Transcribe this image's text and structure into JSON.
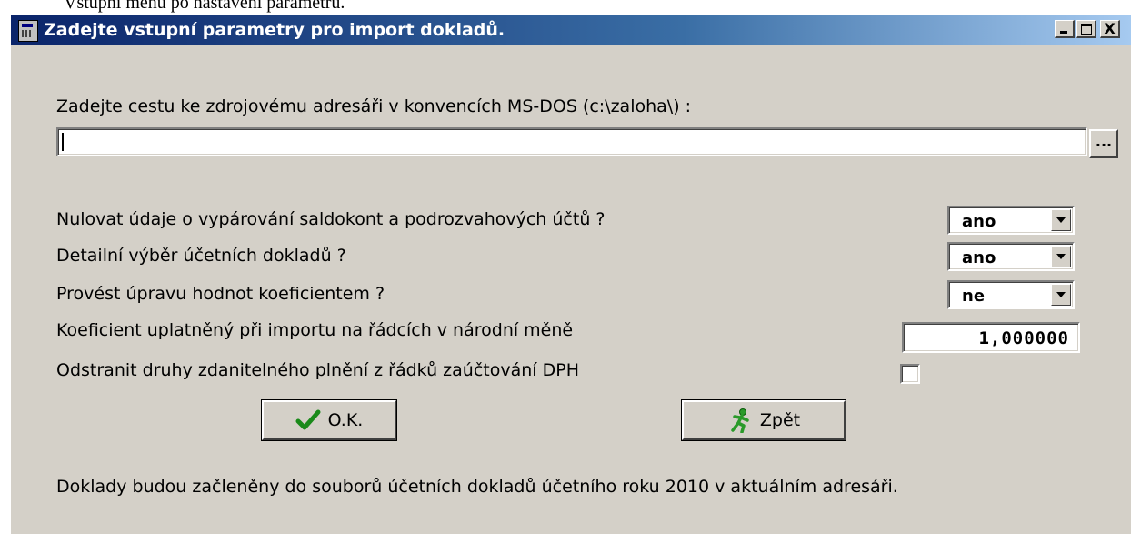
{
  "doc_text": "Vstupní menu po nastavení parametrů.",
  "window": {
    "title": "Zadejte vstupní parametry pro import dokladů.",
    "buttons": {
      "minimize": "_",
      "maximize": "□",
      "close": "X"
    }
  },
  "path": {
    "label": "Zadejte cestu ke zdrojovému adresáři v konvencích MS-DOS (c:\\zaloha\\) :",
    "value": "",
    "browse_label": "..."
  },
  "options": [
    {
      "label": "Nulovat údaje o vypárování saldokont a podrozvahových účtů ?",
      "value": "ano"
    },
    {
      "label": "Detailní výběr účetních dokladů ?",
      "value": "ano"
    },
    {
      "label": "Provést úpravu hodnot koeficientem ?",
      "value": "ne"
    }
  ],
  "coefficient": {
    "label": "Koeficient uplatněný při importu na řádcích v národní měně",
    "value": "1,000000"
  },
  "remove_vat": {
    "label": "Odstranit druhy zdanitelného plnění z řádků zaúčtování DPH",
    "checked": false
  },
  "actions": {
    "ok_label": "O.K.",
    "back_label": "Zpět"
  },
  "footer": "Doklady budou začleněny do souborů účetních dokladů účetního roku 2010 v aktuálním adresáři.",
  "colors": {
    "titlebar_start": "#0a246a",
    "titlebar_end": "#a6caf0",
    "dialog_bg": "#d4d0c8"
  }
}
